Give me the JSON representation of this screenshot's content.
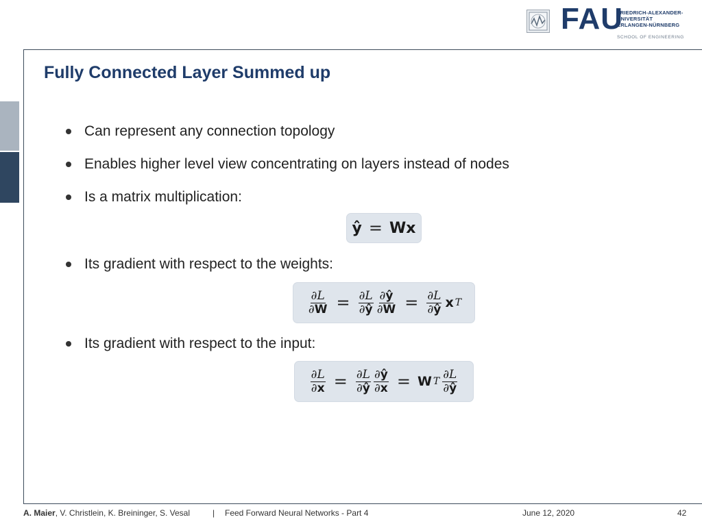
{
  "header": {
    "logo_word": "FAU",
    "logo_lines": [
      "FRIEDRICH-ALEXANDER-",
      "UNIVERSITÄT",
      "ERLANGEN-NÜRNBERG"
    ],
    "logo_school": "SCHOOL OF ENGINEERING"
  },
  "slide": {
    "title": "Fully Connected Layer Summed up",
    "bullets": [
      "Can represent any connection topology",
      "Enables higher level view concentrating on layers instead of nodes",
      "Is a matrix multiplication:",
      "Its gradient with respect to the weights:",
      "Its gradient with respect to the input:"
    ]
  },
  "footer": {
    "lead_author": "A. Maier",
    "other_authors": ", V. Christlein, K. Breininger, S. Vesal",
    "separator": "|",
    "lecture": "Feed Forward Neural Networks - Part 4",
    "date": "June 12, 2020",
    "page": "42"
  },
  "colors": {
    "title": "#1f3c6a",
    "equation_box": "#dfe5ec",
    "side_tab_light": "#aab4bf",
    "side_tab_dark": "#2f4660"
  },
  "icons": [
    "fau-seal-icon"
  ]
}
